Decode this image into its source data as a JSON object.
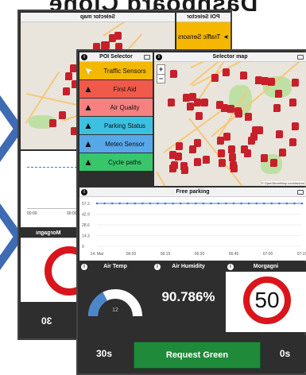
{
  "mirror_heading": "Dashboard Clone",
  "back_window": {
    "map_title": "Selector map",
    "poi_title": "POI Selector",
    "poi_first_label": "Traffic Sensors",
    "chart_times": [
      "00:00",
      "00:00"
    ],
    "speed_tile_title": "Morgagni",
    "bottom_value": "30"
  },
  "front_window": {
    "poi_selector": {
      "title": "POI Selector",
      "items": [
        {
          "label": "Traffic Sensors",
          "icon": "cursor-icon",
          "color": "#f5b800"
        },
        {
          "label": "First Aid",
          "icon": "navigation-arrow-icon",
          "color": "#f05a4a"
        },
        {
          "label": "Air Quality",
          "icon": "navigation-arrow-icon",
          "color": "#f78080"
        },
        {
          "label": "Parking Status",
          "icon": "navigation-arrow-icon",
          "color": "#3cc0e0"
        },
        {
          "label": "Meteo Sensor",
          "icon": "navigation-arrow-icon",
          "color": "#58a7e8"
        },
        {
          "label": "Cycle paths",
          "icon": "navigation-arrow-icon",
          "color": "#39c66a"
        }
      ]
    },
    "map": {
      "title": "Selector map",
      "zoom_in": "+",
      "zoom_out": "−",
      "attribution": "© OpenStreetMap contributors"
    },
    "parking_chart": {
      "title": "Free parking",
      "y_ticks": [
        "57.2",
        "42.9",
        "28.6",
        "14.3",
        "0"
      ],
      "x_ticks": [
        "14. Mar",
        "06:00",
        "06:15",
        "06:30",
        "06:45",
        "07:00",
        "07:15"
      ]
    },
    "air_temp": {
      "title": "Air Temp",
      "value": "12",
      "gauge_level": 0.35
    },
    "air_humidity": {
      "title": "Air Humidity",
      "value": "90.786%"
    },
    "speed_limit": {
      "title": "Morgagni",
      "value": "50"
    },
    "bottom_bar": {
      "left_timer": "30s",
      "request_button": "Request Green",
      "right_timer": "0s"
    }
  },
  "chart_data": {
    "type": "line",
    "title": "Free parking",
    "x": [
      "14. Mar",
      "06:00",
      "06:15",
      "06:30",
      "06:45",
      "07:00",
      "07:15"
    ],
    "series": [
      {
        "values": [
          57.2,
          57.2,
          57.2,
          57.2,
          57.2,
          57.2,
          57.2,
          57.2,
          57.2,
          57.2,
          57.2,
          57.2,
          57.2,
          57.2,
          57.2,
          57.2,
          57.2,
          57.2,
          57.2,
          57.2,
          57.2,
          57.2,
          57.2,
          57.2,
          57.2,
          57.2,
          57.2,
          57.2
        ]
      }
    ],
    "ylim": [
      0,
      57.2
    ],
    "y_ticks": [
      0,
      14.3,
      28.6,
      42.9,
      57.2
    ]
  },
  "colors": {
    "dark": "#2e2e2e",
    "marker": "#c7202a",
    "arrow": "#3f6bb3",
    "green_button": "#1f8a3a",
    "series_line": "#3a7bd5"
  }
}
